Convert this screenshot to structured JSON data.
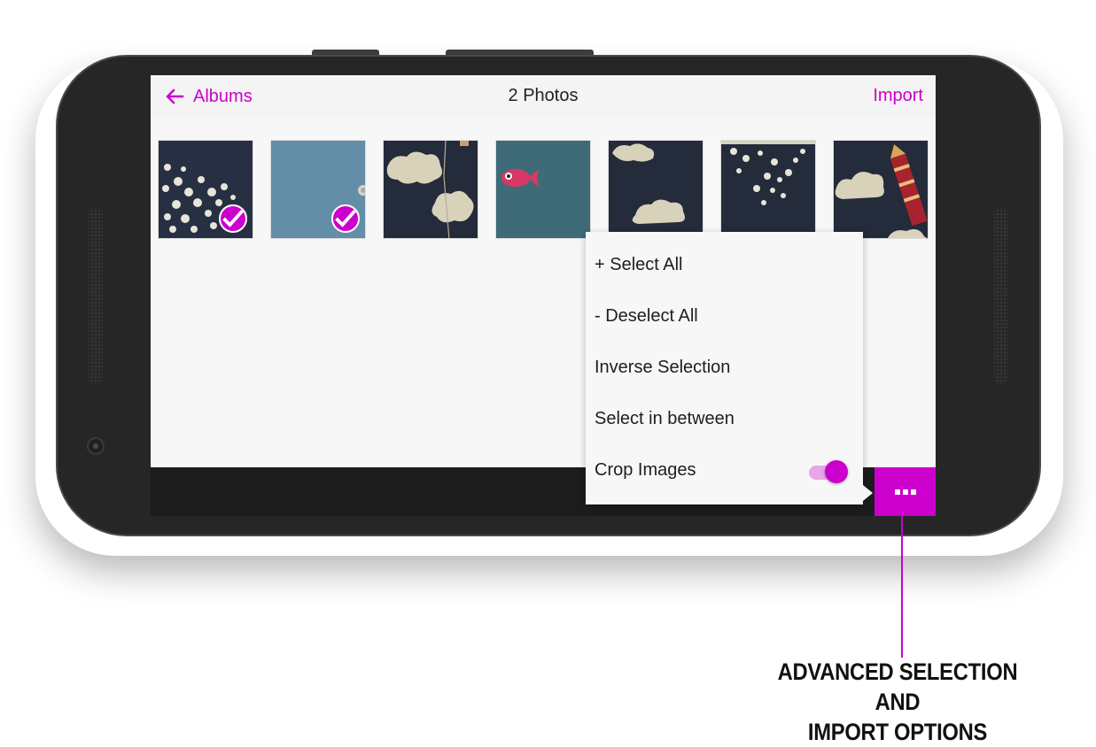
{
  "header": {
    "back_label": "Albums",
    "title": "2 Photos",
    "import_label": "Import"
  },
  "photos": [
    {
      "name": "confetti-dots",
      "selected": true
    },
    {
      "name": "blue-paper",
      "selected": true
    },
    {
      "name": "clouds-string",
      "selected": false
    },
    {
      "name": "red-fish",
      "selected": false
    },
    {
      "name": "cloud-bottom",
      "selected": false
    },
    {
      "name": "confetti-scatter",
      "selected": false
    },
    {
      "name": "cloud-rocket",
      "selected": false
    }
  ],
  "menu": {
    "items": [
      "+ Select All",
      "- Deselect All",
      "Inverse Selection",
      "Select in between",
      "Crop Images"
    ],
    "crop_toggle_on": true
  },
  "more_button": {
    "icon": "more-dots-icon"
  },
  "callout": {
    "line1": "ADVANCED SELECTION AND",
    "line2": "IMPORT OPTIONS"
  },
  "colors": {
    "accent": "#cc00cc",
    "phone": "#262626",
    "screen": "#f7f7f7"
  }
}
